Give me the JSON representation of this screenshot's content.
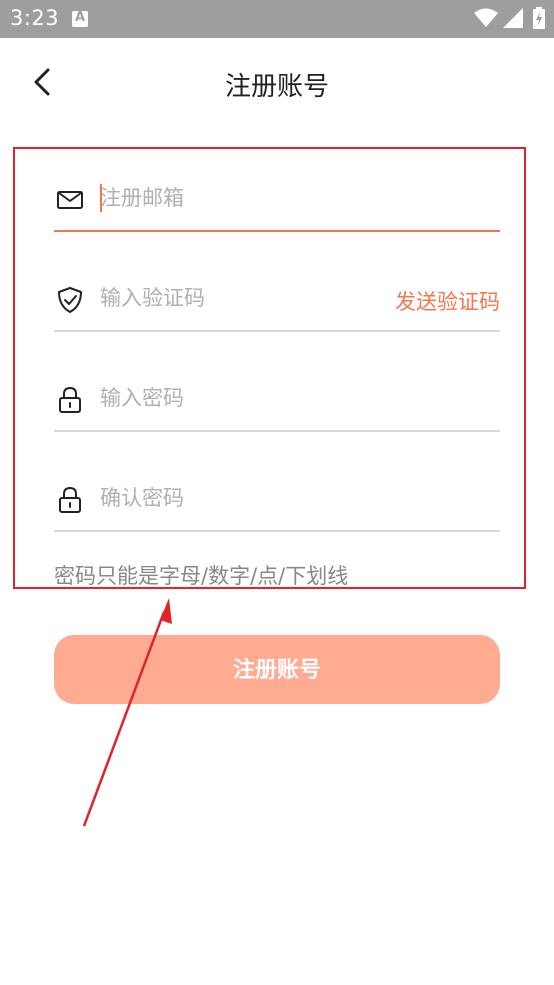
{
  "status_bar": {
    "time": "3:23",
    "icons": [
      "notification-a-icon",
      "wifi-icon",
      "signal-icon",
      "battery-icon"
    ]
  },
  "header": {
    "title": "注册账号",
    "back_icon": "chevron-left-icon"
  },
  "form": {
    "email": {
      "placeholder": "注册邮箱",
      "icon": "mail-icon"
    },
    "code": {
      "placeholder": "输入验证码",
      "icon": "shield-check-icon",
      "send_label": "发送验证码"
    },
    "password": {
      "placeholder": "输入密码",
      "icon": "lock-icon"
    },
    "confirm": {
      "placeholder": "确认密码",
      "icon": "lock-icon"
    },
    "hint": "密码只能是字母/数字/点/下划线",
    "submit_label": "注册账号"
  },
  "colors": {
    "accent": "#f4764f",
    "button_bg": "#ffab91",
    "annotation": "#e0232d",
    "status_bar": "#9e9e9e"
  }
}
